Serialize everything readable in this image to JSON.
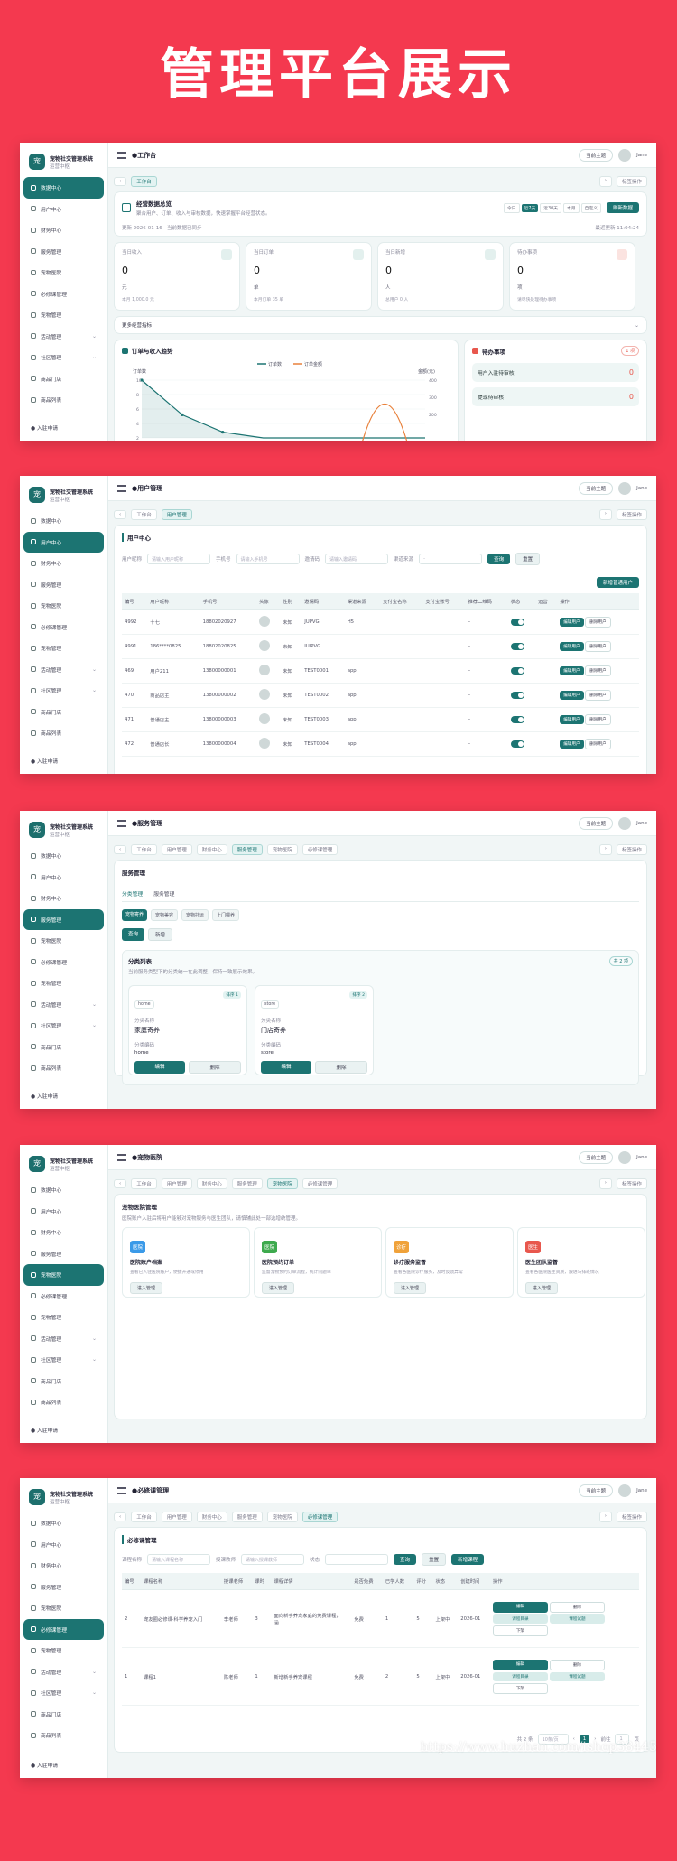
{
  "headline": "管理平台展示",
  "app": {
    "name": "宠物社交管理系统",
    "subtitle": "运营中枢",
    "logo": "宠"
  },
  "sidebar": {
    "items": [
      "数据中心",
      "用户中心",
      "财务中心",
      "服务管理",
      "宠物医院",
      "必修课管理",
      "宠物管理",
      "活动管理",
      "社区管理",
      "商品门店",
      "商品列表"
    ],
    "expandable": [
      7,
      8
    ],
    "footer": "入驻申请"
  },
  "topbar": {
    "theme_label": "当前主题",
    "user": "Jane"
  },
  "common": {
    "more": "标签操作"
  },
  "colors": {
    "accent": "#1c7472",
    "background": "#f4394f"
  },
  "screen1": {
    "title": "●工作台",
    "tabs": [
      "工作台"
    ],
    "banner_title": "经营数据总览",
    "banner_desc": "聚合用户、订单、收入与审核数据，快速掌握平台经营状态。",
    "banner_update": "更新 2026-01-16 · 当前数据已同步",
    "banner_right": "最近更新 11:04:24",
    "range": [
      "今日",
      "近7天",
      "近30天",
      "本月",
      "自定义"
    ],
    "refresh": "刷新数据",
    "stats": [
      {
        "label": "当日收入",
        "value": "0",
        "unit": "元",
        "sub": "本月 1,000.0 元"
      },
      {
        "label": "当日订单",
        "value": "0",
        "unit": "单",
        "sub": "本月订单 35 单"
      },
      {
        "label": "当日新增",
        "value": "0",
        "unit": "人",
        "sub": "总用户 0 人"
      },
      {
        "label": "待办事项",
        "value": "0",
        "unit": "项",
        "sub": "请尽快处理待办事项"
      }
    ],
    "more": "更多经营指标",
    "chart_title": "订单与收入趋势",
    "legend": [
      "订单数",
      "订单金额"
    ],
    "left_axis": "订单数",
    "right_axis": "金额(元)",
    "todo_title": "待办事项",
    "todo_badge": "1 项",
    "todos": [
      {
        "label": "用户入驻待审核",
        "count": "0"
      },
      {
        "label": "提现待审核",
        "count": "0"
      }
    ]
  },
  "chart_data": {
    "type": "line",
    "title": "订单与收入趋势",
    "ylabel": "订单数",
    "y2label": "金额(元)",
    "yticks": [
      "10",
      "8",
      "6",
      "4",
      "2"
    ],
    "y2ticks": [
      "400",
      "300",
      "200"
    ],
    "series": [
      {
        "name": "订单数",
        "values": [
          10,
          4,
          1,
          0,
          0,
          0,
          0,
          0
        ]
      },
      {
        "name": "订单金额",
        "values": [
          0,
          0,
          0,
          0,
          0,
          0,
          380,
          0
        ]
      }
    ]
  },
  "screen2": {
    "title": "●用户管理",
    "tabs": [
      "工作台",
      "用户管理"
    ],
    "section": "用户中心",
    "filters": [
      {
        "label": "用户昵称",
        "ph": "请输入用户昵称"
      },
      {
        "label": "手机号",
        "ph": "请输入手机号"
      },
      {
        "label": "邀请码",
        "ph": "请输入邀请码"
      },
      {
        "label": "渠道来源",
        "ph": "-"
      }
    ],
    "search": "查询",
    "reset": "重置",
    "add": "新增普通用户",
    "columns": [
      "编号",
      "用户昵称",
      "手机号",
      "头像",
      "性别",
      "邀请码",
      "渠道来源",
      "支付宝名称",
      "支付宝账号",
      "推荐二维码",
      "状态",
      "运营",
      "操作"
    ],
    "rows": [
      [
        "4992",
        "十七",
        "18802020927",
        "未知",
        "JUPVG",
        "H5",
        "",
        "",
        "–"
      ],
      [
        "4991",
        "186****0825",
        "18802020825",
        "未知",
        "IUIPVG",
        "",
        "",
        "",
        "–"
      ],
      [
        "469",
        "用户211",
        "13800000001",
        "未知",
        "TEST0001",
        "app",
        "",
        "",
        "–"
      ],
      [
        "470",
        "商品店主",
        "13800000002",
        "未知",
        "TEST0002",
        "app",
        "",
        "",
        "–"
      ],
      [
        "471",
        "普通店主",
        "13800000003",
        "未知",
        "TEST0003",
        "app",
        "",
        "",
        "–"
      ],
      [
        "472",
        "普通店长",
        "13800000004",
        "未知",
        "TEST0004",
        "app",
        "",
        "",
        "–"
      ]
    ],
    "edit": "编辑用户",
    "del": "删除用户"
  },
  "screen3": {
    "title": "●服务管理",
    "tabs": [
      "工作台",
      "用户管理",
      "财务中心",
      "服务管理",
      "宠物医院",
      "必修课管理"
    ],
    "section": "服务管理",
    "subtabs": [
      "分类管理",
      "服务管理"
    ],
    "chips": [
      "宠物寄养",
      "宠物美容",
      "宠物托运",
      "上门喂养"
    ],
    "search": "查询",
    "add": "新增",
    "list_title": "分类列表",
    "list_desc": "当前服务类型下的分类统一在此调整，保持一致展示效果。",
    "count": "共 2 项",
    "cards": [
      {
        "tag": "home",
        "sort": "排序 1",
        "label": "分类名称",
        "name": "家庭寄养",
        "code_label": "分类编码",
        "code": "home"
      },
      {
        "tag": "store",
        "sort": "排序 2",
        "label": "分类名称",
        "name": "门店寄养",
        "code_label": "分类编码",
        "code": "store"
      }
    ],
    "edit": "编辑",
    "del": "删除"
  },
  "screen4": {
    "title": "●宠物医院",
    "tabs": [
      "工作台",
      "用户管理",
      "财务中心",
      "服务管理",
      "宠物医院",
      "必修课管理"
    ],
    "section": "宠物医院管理",
    "desc": "医院账户入驻后将用户能够对宠物服务与医生团队，请慎辅此处一部选增统管理。",
    "cards": [
      {
        "badge": "医院",
        "color": "#3b9ae8",
        "title": "医院账户档案",
        "desc": "查看已入驻医院账户，便捷开通或停用",
        "btn": "进入管理"
      },
      {
        "badge": "医院",
        "color": "#3eaa4e",
        "title": "医院预约订单",
        "desc": "监督宠物预约订单流程，统计问题单",
        "btn": "进入管理"
      },
      {
        "badge": "诊疗",
        "color": "#f0a23a",
        "title": "诊疗服务监督",
        "desc": "查看各医院诊疗服务，及时反馈异常",
        "btn": "进入管理"
      },
      {
        "badge": "医生",
        "color": "#e8574d",
        "title": "医生团队监督",
        "desc": "查看各医院医生资质，跟进与排班情况",
        "btn": "进入管理"
      }
    ]
  },
  "screen5": {
    "title": "●必修课管理",
    "tabs": [
      "工作台",
      "用户管理",
      "财务中心",
      "服务管理",
      "宠物医院",
      "必修课管理"
    ],
    "section": "必修课管理",
    "filters": [
      {
        "label": "课程名称",
        "ph": "请输入课程名称"
      },
      {
        "label": "授课教师",
        "ph": "请输入授课教师"
      },
      {
        "label": "状态",
        "ph": "-"
      }
    ],
    "search": "查询",
    "reset": "重置",
    "add": "新增课程",
    "columns": [
      "编号",
      "课程名称",
      "授课老师",
      "课时",
      "课程详情",
      "是否免费",
      "已学人数",
      "评分",
      "状态",
      "创建时间",
      "操作"
    ],
    "rows": [
      [
        "2",
        "宠友圈必修课·科学养宠入门",
        "李老师",
        "3",
        "面向新手养宠家庭的免费课程，涵...",
        "免费",
        "1",
        "5",
        "上架中",
        "2026-01"
      ],
      [
        "1",
        "课程1",
        "陈老师",
        "1",
        "新增新手养宠课程",
        "免费",
        "2",
        "5",
        "上架中",
        "2026-01"
      ]
    ],
    "ops": [
      "编辑",
      "删除",
      "课程目录",
      "课程试题",
      "下架"
    ],
    "pager": {
      "total": "共 2 条",
      "size": "10条/页",
      "page": "1",
      "goto": "前往",
      "pageno": "1",
      "unit": "页"
    }
  },
  "watermark": "https://www.huzhan.com/ishop38445"
}
